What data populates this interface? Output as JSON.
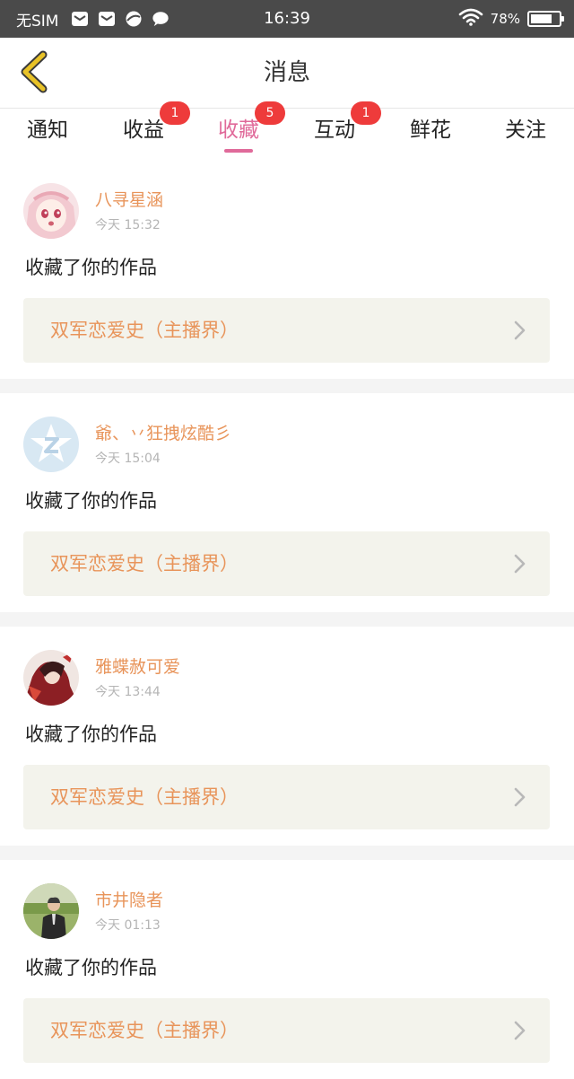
{
  "status_bar": {
    "carrier": "无SIM",
    "time": "16:39",
    "battery_text": "78%",
    "battery_level": 0.78
  },
  "nav": {
    "title": "消息"
  },
  "tabs": [
    {
      "label": "通知",
      "badge": ""
    },
    {
      "label": "收益",
      "badge": "1"
    },
    {
      "label": "收藏",
      "badge": "5",
      "active": true
    },
    {
      "label": "互动",
      "badge": "1"
    },
    {
      "label": "鲜花",
      "badge": ""
    },
    {
      "label": "关注",
      "badge": ""
    }
  ],
  "feed": [
    {
      "user": "八寻星涵",
      "time": "今天 15:32",
      "action": "收藏了你的作品",
      "work": "双军恋爱史（主播界）"
    },
    {
      "user": "爺、丷狂拽炫酷彡",
      "time": "今天 15:04",
      "action": "收藏了你的作品",
      "work": "双军恋爱史（主播界）"
    },
    {
      "user": "雅蝶赦可爱",
      "time": "今天 13:44",
      "action": "收藏了你的作品",
      "work": "双军恋爱史（主播界）"
    },
    {
      "user": "市井隐者",
      "time": "今天 01:13",
      "action": "收藏了你的作品",
      "work": "双军恋爱史（主播界）"
    }
  ],
  "colors": {
    "accent": "#e06a9a",
    "name_orange": "#e8945a",
    "badge_red": "#ee3b3b",
    "back_yellow": "#e8c227"
  }
}
